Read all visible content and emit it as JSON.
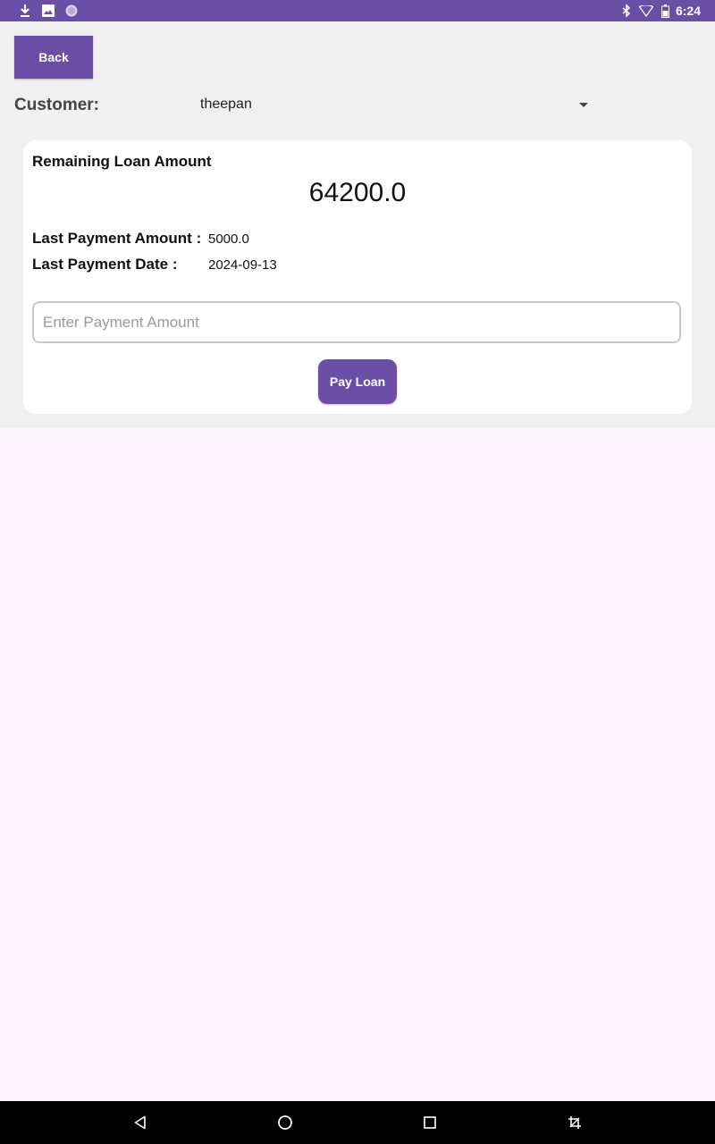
{
  "status_bar": {
    "time": "6:24",
    "left_icons": [
      "download-icon",
      "image-icon",
      "circle-icon"
    ],
    "right_icons": [
      "bluetooth-icon",
      "wifi-icon",
      "battery-icon"
    ],
    "background": "#6b4fa6"
  },
  "header": {
    "back_label": "Back"
  },
  "customer": {
    "label": "Customer:",
    "selected": "theepan"
  },
  "loan_card": {
    "title": "Remaining Loan Amount",
    "remaining_amount": "64200.0",
    "last_payment_amount_label": "Last Payment Amount :",
    "last_payment_amount": "5000.0",
    "last_payment_date_label": "Last Payment Date :",
    "last_payment_date": "2024-09-13",
    "payment_placeholder": "Enter Payment Amount",
    "pay_label": "Pay Loan"
  },
  "nav_bar": {
    "buttons": [
      "back-triangle-icon",
      "home-circle-icon",
      "recents-square-icon",
      "screenshot-crop-icon"
    ]
  },
  "colors": {
    "accent": "#6b4fa6",
    "app_background": "#f0f0f0",
    "page_background": "#fcf5fd",
    "card_background": "#ffffff"
  }
}
